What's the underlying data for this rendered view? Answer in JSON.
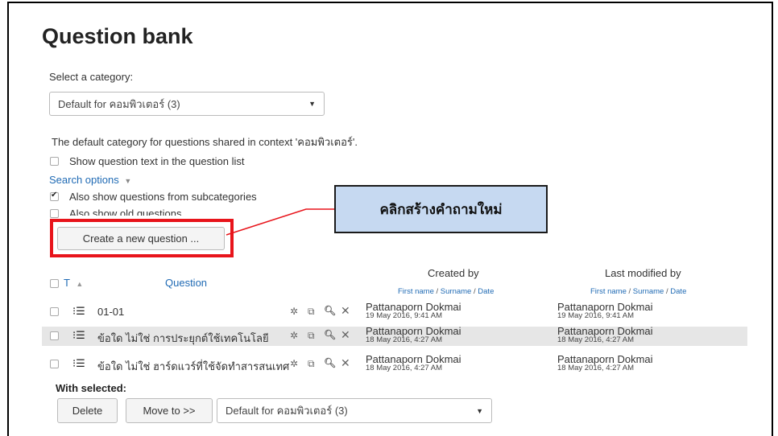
{
  "page_title": "Question bank",
  "category": {
    "label": "Select a category:",
    "selected": "Default for คอมพิวเตอร์ (3)"
  },
  "context_note": "The default category for questions shared in context 'คอมพิวเตอร์'.",
  "options": {
    "show_text_label": "Show question text in the question list",
    "show_text_checked": false,
    "search_options_label": "Search options",
    "subcategories_label": "Also show questions from subcategories",
    "subcategories_checked": true,
    "old_questions_label": "Also show old questions",
    "old_questions_checked": false
  },
  "create_button": "Create a new question ...",
  "callout_text": "คลิกสร้างคำถามใหม่",
  "table": {
    "col_type": "T",
    "col_question": "Question",
    "col_created": "Created by",
    "col_modified": "Last modified by",
    "sub_first": "First name",
    "sub_sep": " / ",
    "sub_surname": "Surname",
    "sub_date": "Date",
    "rows": [
      {
        "question": "01-01",
        "created_name": "Pattanaporn Dokmai",
        "created_date": "19 May 2016, 9:41 AM",
        "modified_name": "Pattanaporn Dokmai",
        "modified_date": "19 May 2016, 9:41 AM"
      },
      {
        "question": "ข้อใด ไม่ใช่ การประยุกต์ใช้เทคโนโลยี",
        "created_name": "Pattanaporn Dokmai",
        "created_date": "18 May 2016, 4:27 AM",
        "modified_name": "Pattanaporn Dokmai",
        "modified_date": "18 May 2016, 4:27 AM"
      },
      {
        "question": "ข้อใด ไม่ใช่ ฮาร์ดแวร์ที่ใช้จัดทำสารสนเทศ",
        "created_name": "Pattanaporn Dokmai",
        "created_date": "18 May 2016, 4:27 AM",
        "modified_name": "Pattanaporn Dokmai",
        "modified_date": "18 May 2016, 4:27 AM"
      }
    ]
  },
  "bulk": {
    "label": "With selected:",
    "delete": "Delete",
    "move": "Move to >>",
    "target": "Default for คอมพิวเตอร์ (3)"
  },
  "icons": {
    "sort": "sort-asc-icon",
    "qtype": "multichoice-icon",
    "edit": "gear-icon",
    "duplicate": "duplicate-icon",
    "preview": "magnifier-icon",
    "delete": "close-icon",
    "dropdown": "caret-down-icon"
  },
  "colors": {
    "link": "#1f6ab4",
    "highlight_box": "#e8141b",
    "callout_bg": "#c6d9f1"
  }
}
